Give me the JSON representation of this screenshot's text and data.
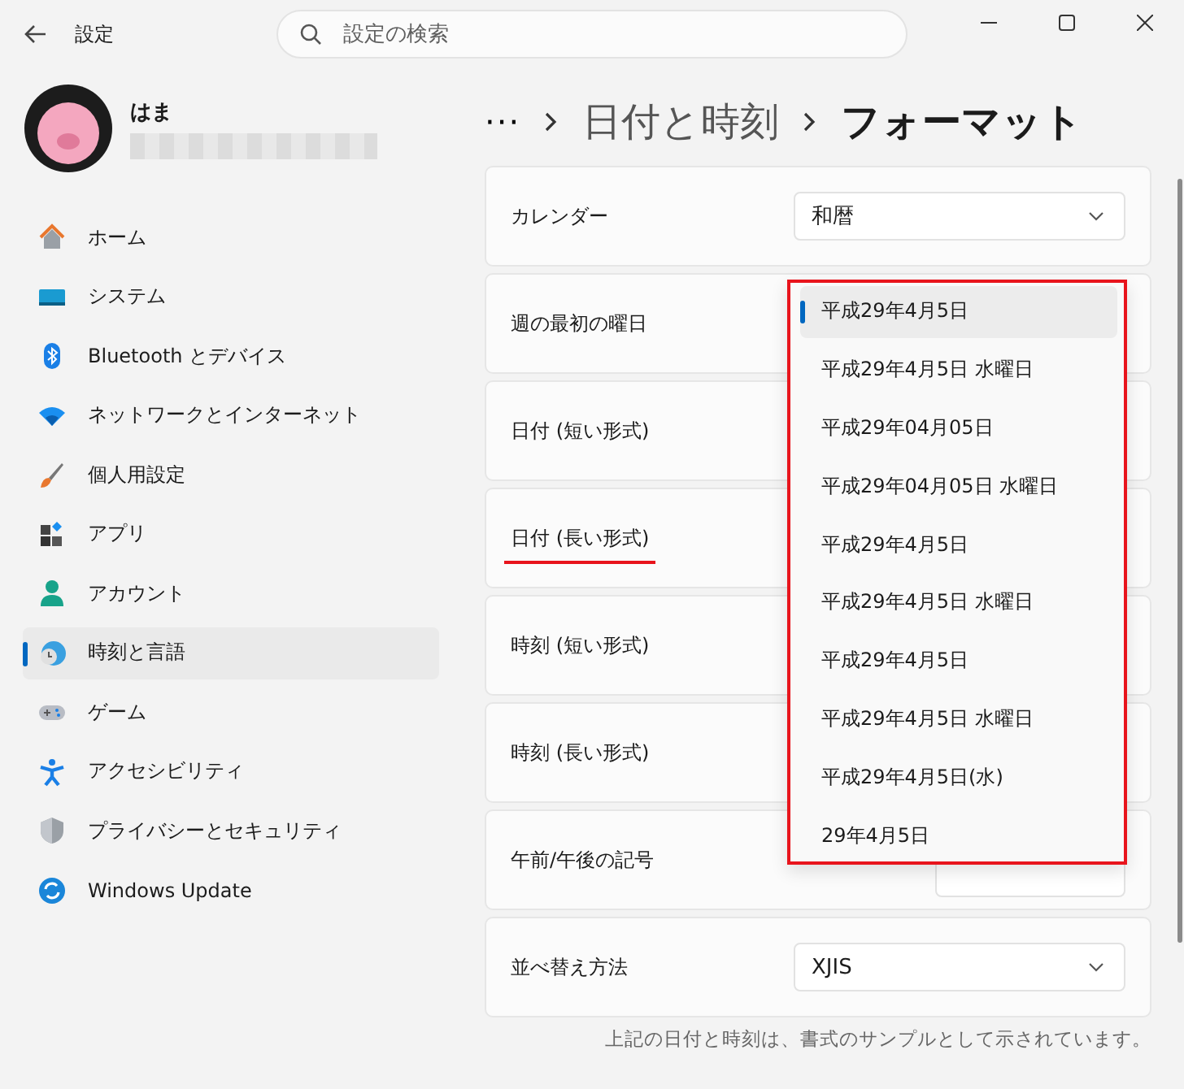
{
  "window": {
    "title": "設定"
  },
  "search": {
    "placeholder": "設定の検索"
  },
  "user": {
    "name": "はま"
  },
  "nav": [
    {
      "label": "ホーム",
      "selected": false
    },
    {
      "label": "システム",
      "selected": false
    },
    {
      "label": "Bluetooth とデバイス",
      "selected": false
    },
    {
      "label": "ネットワークとインターネット",
      "selected": false
    },
    {
      "label": "個人用設定",
      "selected": false
    },
    {
      "label": "アプリ",
      "selected": false
    },
    {
      "label": "アカウント",
      "selected": false
    },
    {
      "label": "時刻と言語",
      "selected": true
    },
    {
      "label": "ゲーム",
      "selected": false
    },
    {
      "label": "アクセシビリティ",
      "selected": false
    },
    {
      "label": "プライバシーとセキュリティ",
      "selected": false
    },
    {
      "label": "Windows Update",
      "selected": false
    }
  ],
  "breadcrumb": {
    "more": "···",
    "items": [
      "日付と時刻",
      "フォーマット"
    ]
  },
  "rows": [
    {
      "label": "カレンダー",
      "underlined": false,
      "kind": "dropdown",
      "value": "和暦"
    },
    {
      "label": "週の最初の曜日",
      "underlined": false,
      "kind": "covered"
    },
    {
      "label": "日付 (短い形式)",
      "underlined": false,
      "kind": "covered"
    },
    {
      "label": "日付 (長い形式)",
      "underlined": true,
      "kind": "covered"
    },
    {
      "label": "時刻 (短い形式)",
      "underlined": false,
      "kind": "covered"
    },
    {
      "label": "時刻 (長い形式)",
      "underlined": false,
      "kind": "covered"
    },
    {
      "label": "午前/午後の記号",
      "underlined": false,
      "kind": "button"
    },
    {
      "label": "並べ替え方法",
      "underlined": false,
      "kind": "dropdown",
      "value": "XJIS"
    }
  ],
  "popup": {
    "highlighted": true,
    "options": [
      {
        "label": "平成29年4月5日",
        "selected": true
      },
      {
        "label": "平成29年4月5日 水曜日",
        "selected": false
      },
      {
        "label": "平成29年04月05日",
        "selected": false
      },
      {
        "label": "平成29年04月05日 水曜日",
        "selected": false
      },
      {
        "label": "平成29年4月5日",
        "selected": false
      },
      {
        "label": "平成29年4月5日 水曜日",
        "selected": false
      },
      {
        "label": "平成29年4月5日",
        "selected": false
      },
      {
        "label": "平成29年4月5日 水曜日",
        "selected": false
      },
      {
        "label": "平成29年4月5日(水)",
        "selected": false
      },
      {
        "label": "29年4月5日",
        "selected": false
      }
    ]
  },
  "note": "上記の日付と時刻は、書式のサンプルとして示されています。"
}
